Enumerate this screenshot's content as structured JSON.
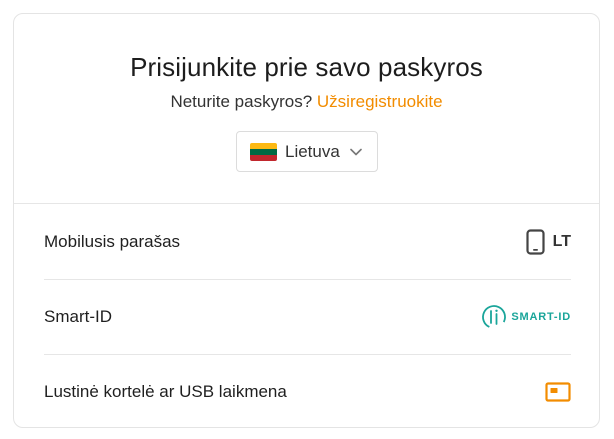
{
  "login": {
    "title": "Prisijunkite prie savo paskyros",
    "no_account_text": "Neturite paskyros?",
    "register_link": "Užsiregistruokite",
    "country": {
      "selected": "Lietuva",
      "flag_colors": [
        "#FDB913",
        "#006A44",
        "#C1272D"
      ]
    },
    "methods": [
      {
        "label": "Mobilusis parašas",
        "badge": "LT",
        "icon": "mobile-phone-icon"
      },
      {
        "label": "Smart-ID",
        "badge": "SMART-ID",
        "icon": "smart-id-logo"
      },
      {
        "label": "Lustinė kortelė ar USB laikmena",
        "icon": "id-card-icon"
      }
    ]
  },
  "colors": {
    "accent": "#F28C00",
    "smart_id": "#1AA59A"
  }
}
